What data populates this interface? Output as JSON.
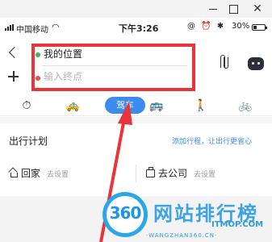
{
  "window": {
    "close_glyph": "✕"
  },
  "statusbar": {
    "carrier": "中国移动",
    "time": "下午3:26",
    "icons": "@ ⏰ ✱",
    "battery": "30%"
  },
  "route": {
    "start": "我的位置",
    "end_placeholder": "输入终点"
  },
  "modes": {
    "items": [
      {
        "name": "recommend-icon",
        "glyph": "⏱"
      },
      {
        "name": "taxi-icon",
        "glyph": "🚕"
      },
      {
        "name": "drive",
        "label": "驾车"
      },
      {
        "name": "bus-icon",
        "glyph": "🚌"
      },
      {
        "name": "walk-icon",
        "glyph": "🚶"
      },
      {
        "name": "bike-icon",
        "glyph": "🚲"
      }
    ],
    "selected": "驾车",
    "accent": "#3a8cf0"
  },
  "plan": {
    "title": "出行计划",
    "link": "添加行程，让出行更省心",
    "home_label": "回家",
    "work_label": "去公司",
    "set_hint": "去设置"
  },
  "annotation": {
    "color": "#e8343a"
  },
  "watermark": {
    "logo": "360",
    "title": "网站排行榜",
    "brand": "ITMOP.COM",
    "sub": "·WANGZHAN360.CN·"
  }
}
